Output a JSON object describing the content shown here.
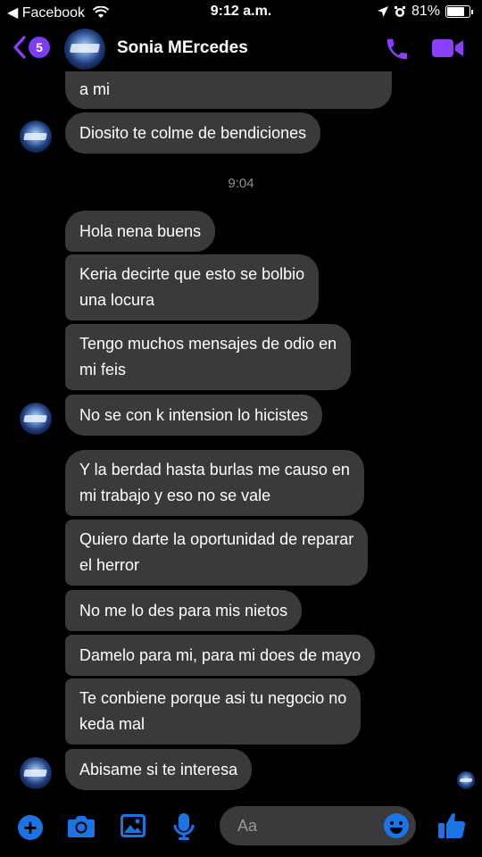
{
  "status_bar": {
    "back_app": "◀ Facebook",
    "time": "9:12 a.m.",
    "battery": "81%"
  },
  "header": {
    "unread_count": "5",
    "contact_name": "Sonia MErcedes"
  },
  "colors": {
    "accent": "#8a3ffc",
    "bubble": "#3a3a3c",
    "timestamp": "#8e8e93",
    "composer_blue": "#1b74e4"
  },
  "messages": {
    "m0": "a mi",
    "m1": "Diosito te colme de bendiciones",
    "timestamp": "9:04",
    "m2": "Hola nena buens",
    "m3": "Keria decirte que esto se bolbio\nuna locura",
    "m4": "Tengo muchos mensajes de odio en\nmi feis",
    "m5": "No se con k intension lo hicistes",
    "m6": "Y la berdad hasta burlas me causo en\nmi trabajo y eso no se vale",
    "m7": "Quiero darte la oportunidad de reparar\nel herror",
    "m8": "No me lo des para mis nietos",
    "m9": "Damelo para mi, para mi does de mayo",
    "m10": "Te conbiene porque asi tu negocio no\nkeda mal",
    "m11": "Abisame si te interesa"
  },
  "composer": {
    "placeholder": "Aa"
  },
  "icons": [
    "back-chevron-icon",
    "wifi-icon",
    "location-icon",
    "alarm-icon",
    "battery-icon",
    "phone-icon",
    "video-icon",
    "plus-icon",
    "camera-icon",
    "gallery-icon",
    "mic-icon",
    "emoji-icon",
    "thumbs-up-icon"
  ]
}
